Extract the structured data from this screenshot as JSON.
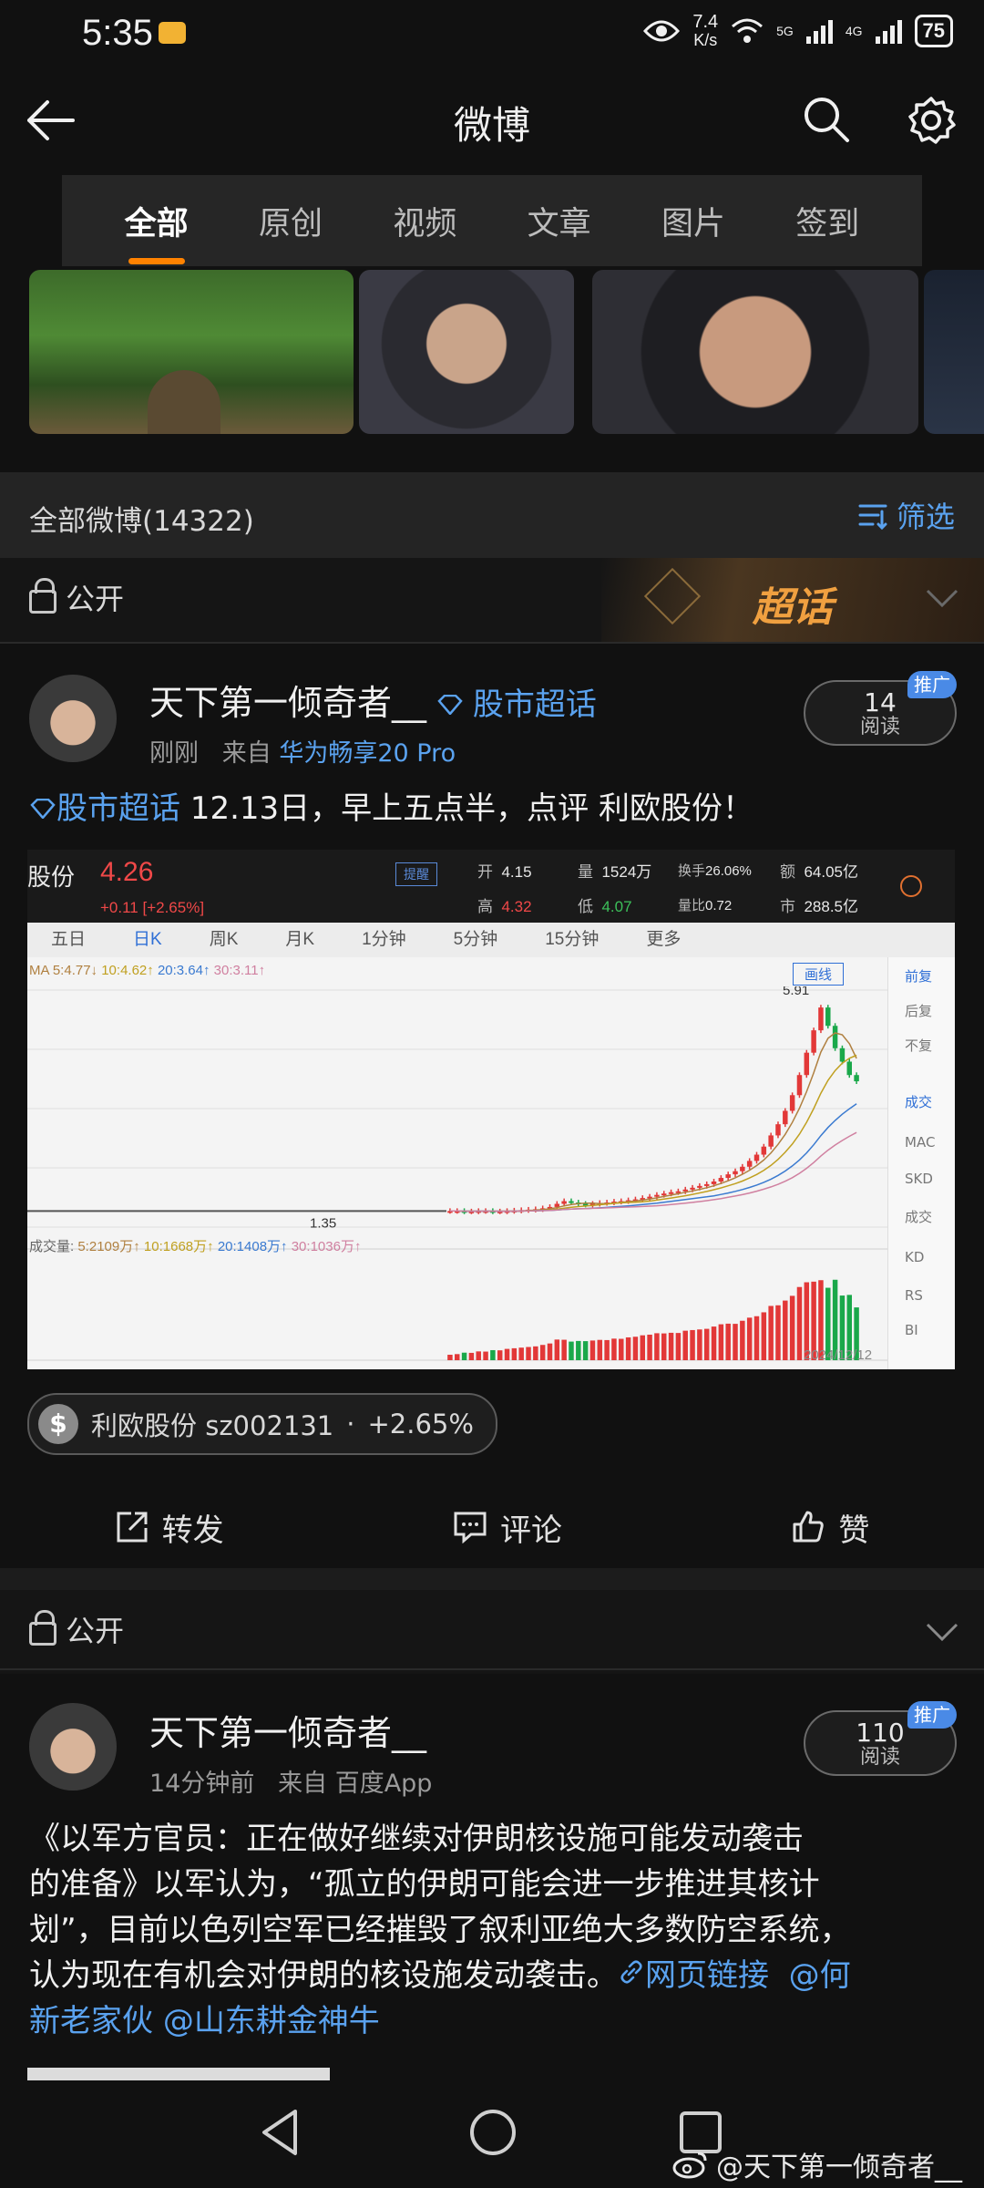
{
  "status": {
    "time": "5:35",
    "speed": "7.4",
    "speed_unit": "K/s",
    "net1": "5G",
    "net2": "4G",
    "battery": "75"
  },
  "nav": {
    "title": "微博"
  },
  "tabs": [
    {
      "label": "全部",
      "active": true
    },
    {
      "label": "原创",
      "active": false
    },
    {
      "label": "视频",
      "active": false
    },
    {
      "label": "文章",
      "active": false
    },
    {
      "label": "图片",
      "active": false
    },
    {
      "label": "签到",
      "active": false
    }
  ],
  "feed": {
    "count_label": "全部微博(14322)",
    "filter_label": "筛选"
  },
  "visibility": {
    "label": "公开",
    "super_topic_label": "超话"
  },
  "post1": {
    "author": "天下第一倾奇者__",
    "topic_tag": "股市超话",
    "time": "刚刚",
    "from_prefix": "来自",
    "source": "华为畅享20 Pro",
    "reads": "14",
    "reads_label": "阅读",
    "promo": "推广",
    "text_topic": "股市超话",
    "text": " 12.13日，早上五点半，点评 利欧股份！",
    "stock_chip": {
      "symbol": "$",
      "name": "利欧股份 sz002131",
      "sep": "·",
      "change": "+2.65%"
    }
  },
  "chart_data": {
    "type": "candlestick",
    "header": {
      "name": "股份",
      "price": "4.26",
      "change": "+0.11 [+2.65%]",
      "tag": "提醒",
      "open_label": "开",
      "open": "4.15",
      "high_label": "高",
      "high": "4.32",
      "volume_label": "量",
      "volume": "1524万",
      "low_label": "低",
      "low": "4.07",
      "turnover_label": "换手",
      "turnover": "26.06%",
      "vol_ratio_label": "量比",
      "vol_ratio": "0.72",
      "amount_label": "额",
      "amount": "64.05亿",
      "cap_label": "市",
      "cap": "288.5亿"
    },
    "periods": [
      "五日",
      "日K",
      "周K",
      "月K",
      "1分钟",
      "5分钟",
      "15分钟",
      "更多"
    ],
    "active_period": "日K",
    "draw_line_button": "画线",
    "ma_legend": {
      "ma5": "MA 5:4.77↓",
      "ma10": "10:4.62↑",
      "ma20": "20:3.64↑",
      "ma30": "30:3.11↑"
    },
    "vol_legend": {
      "title": "成交量:",
      "v5": "5:2109万↑",
      "v10": "10:1668万↑",
      "v20": "20:1408万↑",
      "v30": "30:1036万↑"
    },
    "side_panel": [
      "前复",
      "后复",
      "不复",
      "成交",
      "MAC",
      "SKD",
      "成交",
      "KD",
      "RS",
      "BI"
    ],
    "max_label": "5.91",
    "min_label": "1.35",
    "date_label": "2024/12/12",
    "closes": [
      1.36,
      1.36,
      1.35,
      1.35,
      1.36,
      1.36,
      1.35,
      1.35,
      1.36,
      1.37,
      1.38,
      1.39,
      1.4,
      1.42,
      1.45,
      1.52,
      1.58,
      1.55,
      1.52,
      1.5,
      1.52,
      1.54,
      1.55,
      1.57,
      1.58,
      1.6,
      1.62,
      1.65,
      1.68,
      1.72,
      1.75,
      1.78,
      1.8,
      1.84,
      1.88,
      1.92,
      1.96,
      2.02,
      2.1,
      2.18,
      2.25,
      2.35,
      2.48,
      2.62,
      2.8,
      3.05,
      3.3,
      3.6,
      3.95,
      4.4,
      4.9,
      5.4,
      5.91,
      5.5,
      5.0,
      4.7,
      4.4,
      4.26
    ],
    "y_range": [
      1.0,
      6.3
    ]
  },
  "actions": {
    "repost": "转发",
    "comment": "评论",
    "like": "赞"
  },
  "post2": {
    "author": "天下第一倾奇者__",
    "time": "14分钟前",
    "from_prefix": "来自",
    "source": "百度App",
    "reads": "110",
    "reads_label": "阅读",
    "promo": "推广",
    "text_line1": "《以军方官员：正在做好继续对伊朗核设施可能发动袭击",
    "text_line2": "的准备》以军认为，“孤立的伊朗可能会进一步推进其核计",
    "text_line3": "划”，目前以色列空军已经摧毁了叙利亚绝大多数防空系统，",
    "text_line4a": "认为现在有机会对伊朗的核设施发动袭击。",
    "link_label": "网页链接",
    "mention1_a": "@何",
    "mention1_b": "新老家伙",
    "mention2": "@山东耕金神牛"
  },
  "watermark": "@天下第一倾奇者__"
}
